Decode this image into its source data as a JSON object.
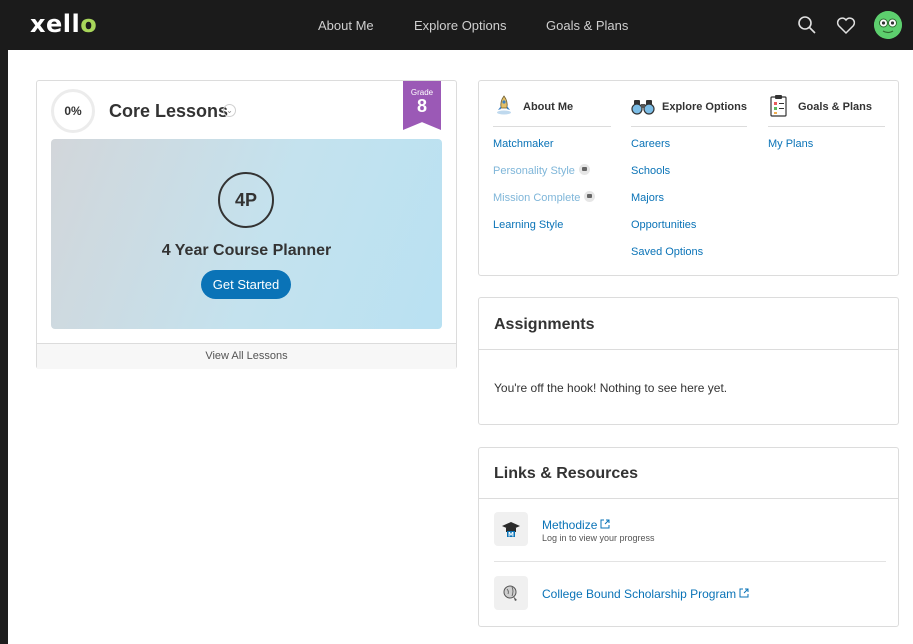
{
  "topbar": {
    "logo": "xello",
    "nav": [
      "About Me",
      "Explore Options",
      "Goals & Plans"
    ]
  },
  "colors": {
    "accent": "#0a73b7",
    "topbar": "#1b1b1b",
    "grade_badge": "#9b59b6",
    "logo_dot": "#a8d65a",
    "avatar": "#5dcf6e"
  },
  "icons": {
    "search": "search-icon",
    "heart": "heart-icon",
    "avatar": "avatar-face-icon",
    "lock": "lock-icon",
    "external_link": "external-link-icon"
  },
  "core": {
    "progress": "0%",
    "progress_value": 0,
    "title": "Core Lessons",
    "grade_label": "Grade",
    "grade_value": "8",
    "lesson_code": "4P",
    "lesson_name": "4 Year Course Planner",
    "cta": "Get Started",
    "view_all": "View All Lessons"
  },
  "nav_card": {
    "about": {
      "title": "About Me",
      "links": [
        {
          "label": "Matchmaker",
          "locked": false
        },
        {
          "label": "Personality Style",
          "locked": true
        },
        {
          "label": "Mission Complete",
          "locked": true
        },
        {
          "label": "Learning Style",
          "locked": false
        }
      ]
    },
    "explore": {
      "title": "Explore Options",
      "links": [
        "Careers",
        "Schools",
        "Majors",
        "Opportunities",
        "Saved Options"
      ]
    },
    "goals": {
      "title": "Goals & Plans",
      "links": [
        "My Plans"
      ]
    }
  },
  "assignments": {
    "title": "Assignments",
    "empty": "You're off the hook! Nothing to see here yet."
  },
  "links": {
    "title": "Links & Resources",
    "items": [
      {
        "title": "Methodize",
        "subtitle": "Log in to view your progress"
      },
      {
        "title": "College Bound Scholarship Program",
        "subtitle": ""
      }
    ]
  }
}
